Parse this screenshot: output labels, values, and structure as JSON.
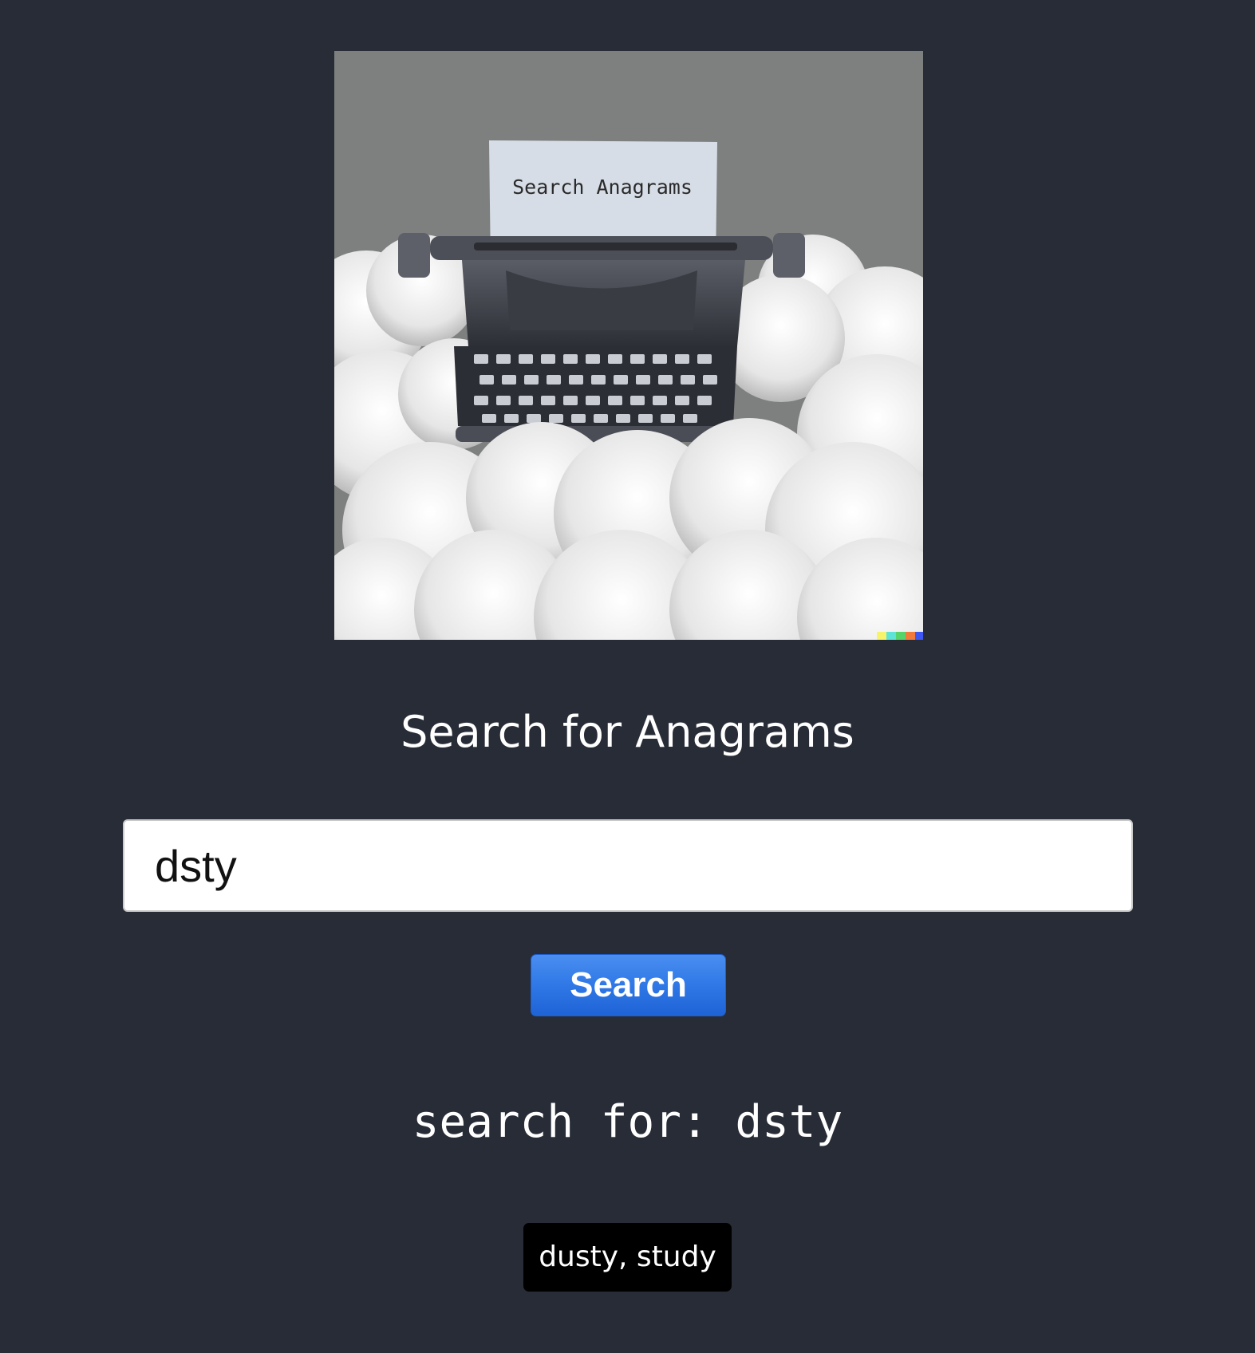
{
  "hero_image": {
    "paper_text": "Search Anagrams",
    "alt": "Typewriter floating on clouds"
  },
  "page": {
    "heading": "Search for Anagrams"
  },
  "search": {
    "input_value": "dsty",
    "button_label": "Search",
    "echo_text": "search for: dsty"
  },
  "results": {
    "text": "dusty, study"
  },
  "colors": {
    "background": "#282c37",
    "button": "#2f78e6",
    "result_chip": "#000000",
    "input_bg": "#ffffff"
  }
}
